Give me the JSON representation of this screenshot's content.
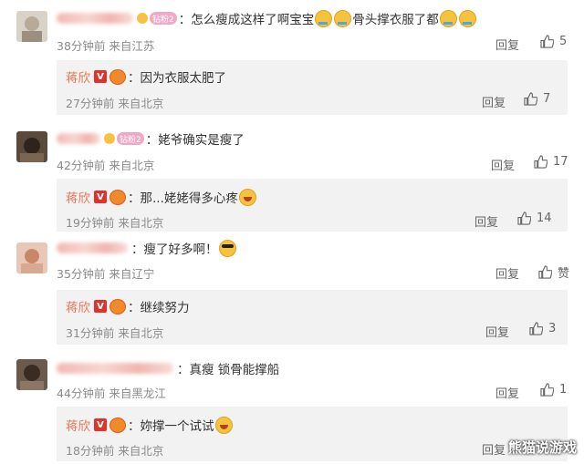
{
  "comments": [
    {
      "text": "：怎么瘦成这样了啊宝宝",
      "text_tail": "骨头撑衣服了都",
      "badge": "钻粉2",
      "time": "38分钟前",
      "location": "来自江苏",
      "reply_label": "回复",
      "likes": "5",
      "reply": {
        "name": "蒋欣",
        "text": "：因为衣服太肥了",
        "time": "27分钟前",
        "location": "来自北京",
        "reply_label": "回复",
        "likes": "7"
      }
    },
    {
      "text": "：姥爷确实是瘦了",
      "badge": "钻粉2",
      "time": "42分钟前",
      "location": "来自北京",
      "reply_label": "回复",
      "likes": "17",
      "reply": {
        "name": "蒋欣",
        "text": "：那...姥姥得多心疼",
        "time": "19分钟前",
        "location": "来自北京",
        "reply_label": "回复",
        "likes": "14"
      }
    },
    {
      "text": "：瘦了好多啊！",
      "time": "35分钟前",
      "location": "来自辽宁",
      "reply_label": "回复",
      "likes": "赞",
      "reply": {
        "name": "蒋欣",
        "text": "：继续努力",
        "time": "31分钟前",
        "location": "来自北京",
        "reply_label": "回复",
        "likes": "3"
      }
    },
    {
      "text": "：真瘦 锁骨能撑船",
      "time": "44分钟前",
      "location": "来自黑龙江",
      "reply_label": "回复",
      "likes": "1",
      "reply": {
        "name": "蒋欣",
        "text": "：妳撑一个试试",
        "time": "18分钟前",
        "location": "来自北京",
        "reply_label": "回复",
        "likes": ""
      }
    }
  ],
  "watermark": "熊猫说游戏",
  "colors": {
    "reply_name": "#eb7350",
    "vip_badge": "#e0322a",
    "background": "#ffffff",
    "reply_bg": "#f2f2f2"
  },
  "icons": [
    "avatar",
    "crown-icon",
    "fan-badge",
    "v-icon",
    "lion-icon",
    "crying-emoji",
    "laugh-emoji",
    "sunglasses-emoji",
    "thumbs-up-icon"
  ]
}
